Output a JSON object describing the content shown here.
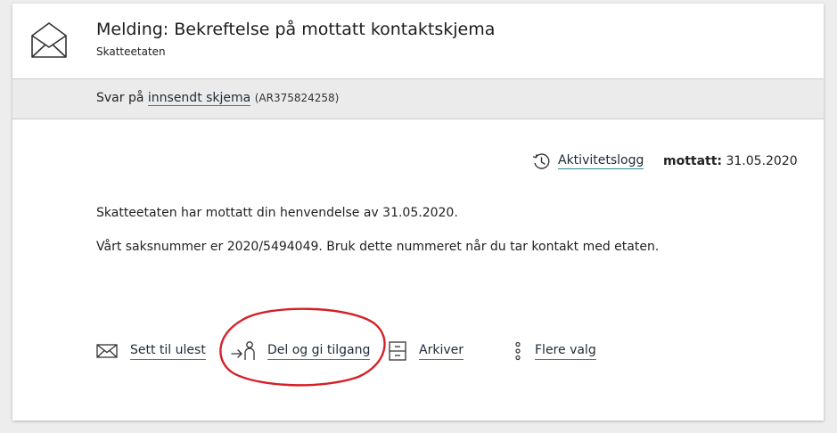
{
  "message": {
    "title": "Melding: Bekreftelse på mottatt kontaktskjema",
    "sender": "Skatteetaten"
  },
  "reply": {
    "prefix": "Svar på",
    "link_label": "innsendt skjema",
    "reference": "(AR375824258)"
  },
  "meta": {
    "activity_log_label": "Aktivitetslogg",
    "received_label": "mottatt:",
    "received_date": "31.05.2020"
  },
  "body": {
    "paragraph1": "Skatteetaten har mottatt din henvendelse av 31.05.2020.",
    "paragraph2": "Vårt saksnummer er 2020/5494049. Bruk dette nummeret når du tar kontakt med etaten."
  },
  "actions": {
    "mark_unread": "Sett til ulest",
    "share_access": "Del og gi tilgang",
    "archive": "Arkiver",
    "more_options": "Flere valg"
  },
  "colors": {
    "link_underline": "#2a8a9a",
    "highlight_circle": "#d42027",
    "reply_bar_bg": "#ebebeb"
  }
}
